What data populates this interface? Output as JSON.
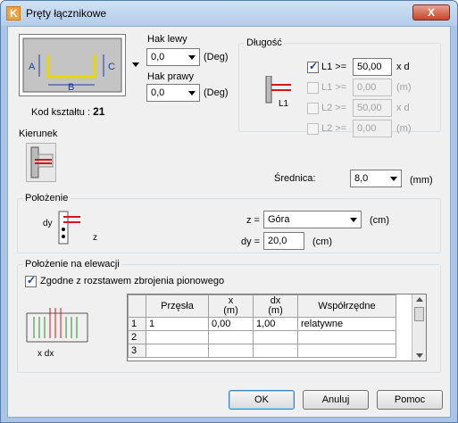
{
  "window": {
    "title": "Pręty łącznikowe",
    "close_label": "X"
  },
  "shape": {
    "label_a": "A",
    "label_b": "B",
    "label_c": "C",
    "code_label": "Kod kształtu :",
    "code_value": "21"
  },
  "hooks": {
    "left_label": "Hak lewy",
    "left_value": "0,0",
    "right_label": "Hak prawy",
    "right_value": "0,0",
    "unit": "(Deg)"
  },
  "length": {
    "title": "Długość",
    "diagram_label": "L1",
    "rows": [
      {
        "label": "L1 >=",
        "value": "50,00",
        "unit": "x d",
        "checked": true,
        "enabled": true
      },
      {
        "label": "L1 >=",
        "value": "0,00",
        "unit": "(m)",
        "checked": false,
        "enabled": false
      },
      {
        "label": "L2 >=",
        "value": "50,00",
        "unit": "x d",
        "checked": false,
        "enabled": false
      },
      {
        "label": "L2 >=",
        "value": "0,00",
        "unit": "(m)",
        "checked": false,
        "enabled": false
      }
    ]
  },
  "direction": {
    "title": "Kierunek"
  },
  "diameter": {
    "label": "Średnica:",
    "value": "8,0",
    "unit": "(mm)"
  },
  "position": {
    "title": "Położenie",
    "z_label": "z =",
    "z_value": "Góra",
    "z_unit": "(cm)",
    "dy_label": "dy =",
    "dy_value": "20,0",
    "dy_unit": "(cm)",
    "diagram_dy": "dy",
    "diagram_z": "z"
  },
  "elevation": {
    "title": "Położenie na elewacji",
    "checkbox_label": "Zgodne z rozstawem zbrojenia pionowego",
    "checkbox_checked": true,
    "diagram_label": "x  dx",
    "columns": [
      "Przęsła",
      "x\n(m)",
      "dx\n(m)",
      "Współrzędne"
    ],
    "rows": [
      {
        "num": "1",
        "cells": [
          "1",
          "0,00",
          "1,00",
          "relatywne"
        ]
      },
      {
        "num": "2",
        "cells": [
          "",
          "",
          "",
          ""
        ]
      },
      {
        "num": "3",
        "cells": [
          "",
          "",
          "",
          ""
        ]
      }
    ]
  },
  "buttons": {
    "ok": "OK",
    "cancel": "Anuluj",
    "help": "Pomoc"
  },
  "colors": {
    "accent": "#3c7fb1",
    "title_bar": "#b3cdea",
    "rebar_yellow": "#e8d800",
    "rebar_red": "#d01818"
  }
}
